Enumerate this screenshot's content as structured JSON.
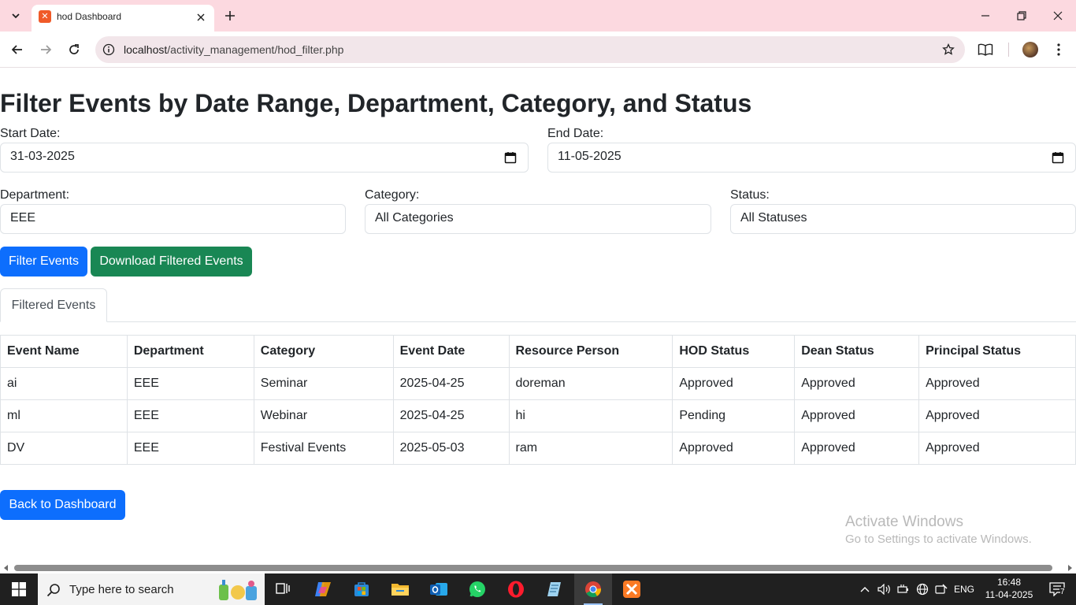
{
  "browser": {
    "tab_title": "hod Dashboard",
    "url_host": "localhost",
    "url_path": "/activity_management/hod_filter.php"
  },
  "page": {
    "heading": "Filter Events by Date Range, Department, Category, and Status",
    "start_date_label": "Start Date:",
    "start_date_value": "31-03-2025",
    "end_date_label": "End Date:",
    "end_date_value": "11-05-2025",
    "department_label": "Department:",
    "department_value": "EEE",
    "category_label": "Category:",
    "category_value": "All Categories",
    "status_label": "Status:",
    "status_value": "All Statuses",
    "filter_button": "Filter Events",
    "download_button": "Download Filtered Events",
    "tab_label": "Filtered Events",
    "back_button": "Back to Dashboard"
  },
  "table": {
    "headers": [
      "Event Name",
      "Department",
      "Category",
      "Event Date",
      "Resource Person",
      "HOD Status",
      "Dean Status",
      "Principal Status"
    ],
    "rows": [
      [
        "ai",
        "EEE",
        "Seminar",
        "2025-04-25",
        "doreman",
        "Approved",
        "Approved",
        "Approved"
      ],
      [
        "ml",
        "EEE",
        "Webinar",
        "2025-04-25",
        "hi",
        "Pending",
        "Approved",
        "Approved"
      ],
      [
        "DV",
        "EEE",
        "Festival Events",
        "2025-05-03",
        "ram",
        "Approved",
        "Approved",
        "Approved"
      ]
    ]
  },
  "watermark": {
    "line1": "Activate Windows",
    "line2": "Go to Settings to activate Windows."
  },
  "taskbar": {
    "search_placeholder": "Type here to search",
    "language": "ENG",
    "time": "16:48",
    "date": "11-04-2025",
    "notification_count": "7"
  },
  "colors": {
    "primary": "#0d6efd",
    "success": "#198754",
    "tabbar": "#fcd9e0",
    "taskbar": "#202020"
  }
}
